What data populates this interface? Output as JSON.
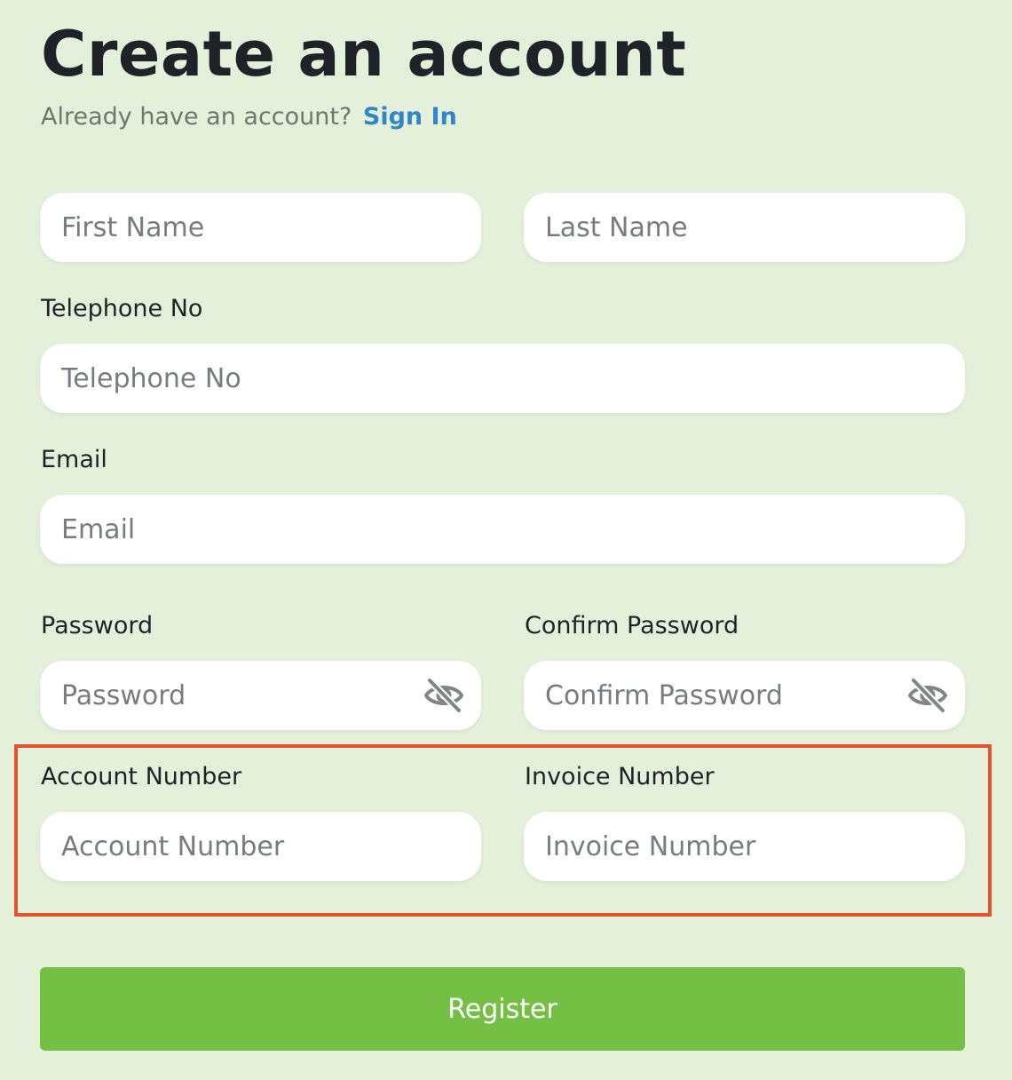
{
  "header": {
    "title": "Create an account",
    "subtitle_prefix": "Already have an account?",
    "sign_in_link": "Sign In"
  },
  "form": {
    "first_name": {
      "placeholder": "First Name",
      "value": ""
    },
    "last_name": {
      "placeholder": "Last Name",
      "value": ""
    },
    "telephone": {
      "label": "Telephone No",
      "placeholder": "Telephone No",
      "value": ""
    },
    "email": {
      "label": "Email",
      "placeholder": "Email",
      "value": ""
    },
    "password": {
      "label": "Password",
      "placeholder": "Password",
      "value": "",
      "icon": "eye-off-icon"
    },
    "confirm_password": {
      "label": "Confirm Password",
      "placeholder": "Confirm Password",
      "value": "",
      "icon": "eye-off-icon"
    },
    "account_number": {
      "label": "Account Number",
      "placeholder": "Account Number",
      "value": ""
    },
    "invoice_number": {
      "label": "Invoice Number",
      "placeholder": "Invoice Number",
      "value": ""
    },
    "register_label": "Register"
  },
  "colors": {
    "background": "#e5f0db",
    "link": "#2f86c8",
    "register_button": "#76bf45",
    "highlight_border": "#e5532e",
    "icon": "#808586"
  }
}
